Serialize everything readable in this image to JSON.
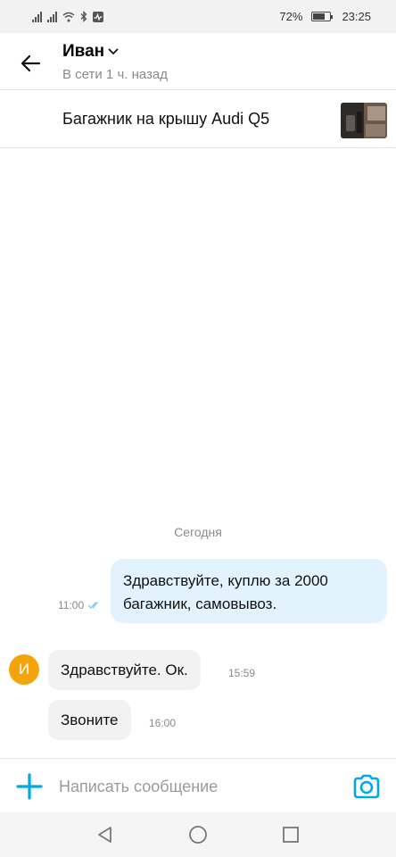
{
  "status_bar": {
    "battery_percent": "72%",
    "battery_level": 0.72,
    "time": "23:25"
  },
  "header": {
    "contact_name": "Иван",
    "contact_status": "В сети 1 ч. назад"
  },
  "ad": {
    "title": "Багажник на крышу Audi Q5"
  },
  "chat": {
    "date_separator": "Сегодня",
    "messages": [
      {
        "direction": "out",
        "line1": "Здравствуйте, куплю за 2000",
        "line2": "багажник, самовывоз.",
        "time": "11:00",
        "read": true
      },
      {
        "direction": "in",
        "text": "Здравствуйте. Ок.",
        "time": "15:59"
      },
      {
        "direction": "in",
        "text": "Звоните",
        "time": "16:00"
      }
    ],
    "avatar_letter": "И"
  },
  "composer": {
    "placeholder": "Написать сообщение"
  },
  "colors": {
    "accent": "#00a8e6",
    "avatar": "#f4a40b",
    "outgoing_bubble": "#e3f3fe",
    "incoming_bubble": "#f2f2f2"
  },
  "icons": {
    "back": "arrow-left-icon",
    "chevron": "chevron-down-icon",
    "plus": "plus-icon",
    "camera": "camera-icon",
    "read_receipt": "double-check-icon"
  }
}
